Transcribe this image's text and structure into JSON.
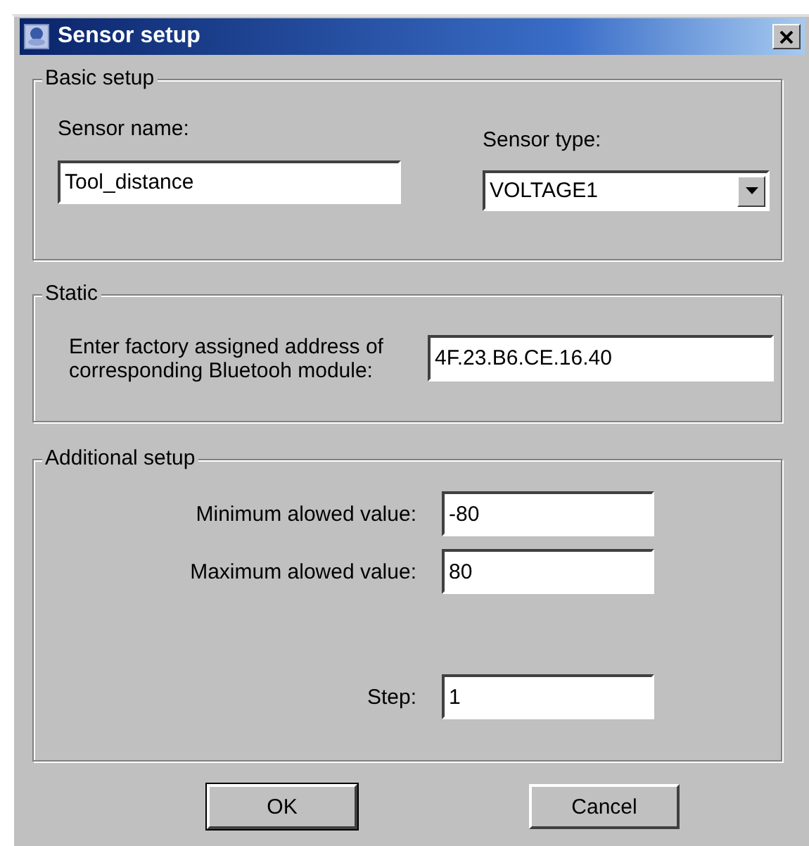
{
  "window": {
    "title": "Sensor setup"
  },
  "basic_setup": {
    "title": "Basic setup",
    "sensor_name": {
      "label": "Sensor name:",
      "value": "Tool_distance"
    },
    "sensor_type": {
      "label": "Sensor type:",
      "value": "VOLTAGE1"
    }
  },
  "static": {
    "title": "Static",
    "address": {
      "label": "Enter factory assigned address of corresponding Bluetooh module:",
      "value": "4F.23.B6.CE.16.40"
    }
  },
  "additional_setup": {
    "title": "Additional setup",
    "fields": [
      {
        "label": "Minimum alowed value:",
        "value": "-80"
      },
      {
        "label": "Maximum alowed value:",
        "value": "80"
      },
      {
        "label": "Step:",
        "value": "1"
      }
    ]
  },
  "buttons": [
    {
      "label": "OK",
      "default": true
    },
    {
      "label": "Cancel",
      "default": false
    }
  ]
}
